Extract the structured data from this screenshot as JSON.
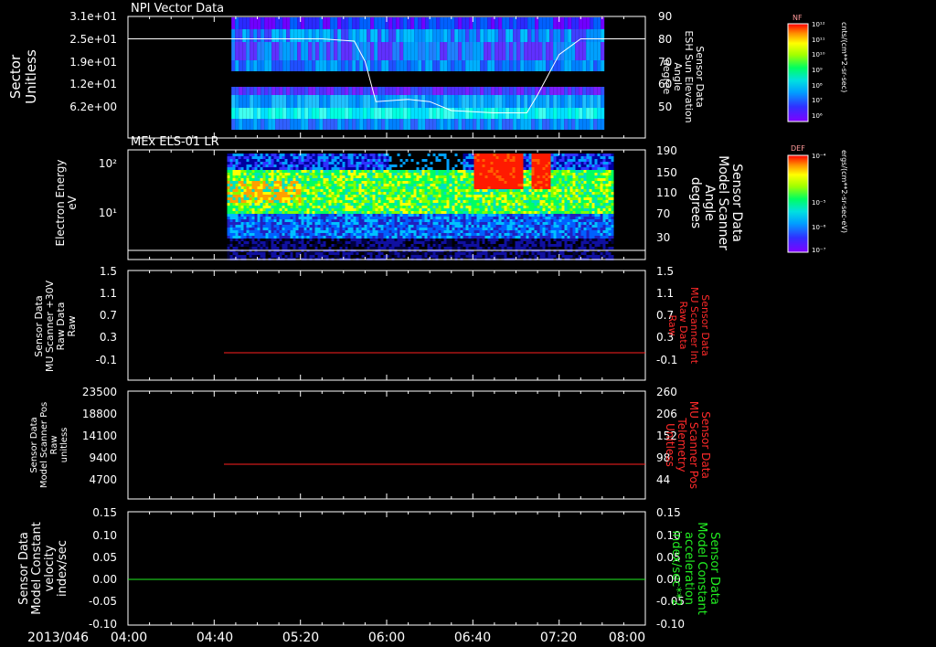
{
  "date_label": "2013/046",
  "time_ticks": [
    "04:00",
    "04:40",
    "05:20",
    "06:00",
    "06:40",
    "07:20",
    "08:00"
  ],
  "colors": {
    "background": "#000000",
    "axes": "#ffffff",
    "red_trace": "#ff2020",
    "green_trace": "#22ee22",
    "right_label_red": "#ff2a2a",
    "right_label_green": "#22ee22"
  },
  "panels": [
    {
      "title": "NPI Vector Data",
      "left_label": [
        "Sector",
        "Unitless"
      ],
      "left_ticks": [
        "3.1e+01",
        "2.5e+01",
        "1.9e+01",
        "1.2e+01",
        "6.2e+00"
      ],
      "right_label": [
        "Sensor Data",
        "ESH Sun Elevation",
        "Angle",
        "degree"
      ],
      "right_ticks": [
        "90",
        "80",
        "70",
        "60",
        "50"
      ],
      "colorbar": {
        "name": "NF",
        "units": "cnts/(cm**2-sr-sec)",
        "ticks": [
          "10¹²",
          "10¹¹",
          "10¹⁰",
          "10⁹",
          "10⁸",
          "10⁷",
          "10⁶"
        ]
      }
    },
    {
      "title": "MEx ELS-01 LR",
      "left_label": [
        "Electron Energy",
        "eV"
      ],
      "left_ticks": [
        "10²",
        "10¹"
      ],
      "right_label": [
        "Sensor Data",
        "Model Scanner",
        "Angle",
        "degrees"
      ],
      "right_ticks": [
        "190",
        "150",
        "110",
        "70",
        "30"
      ],
      "colorbar": {
        "name": "DEF",
        "units": "ergs/(cm**2-sr-sec-eV)",
        "ticks": [
          "10⁻⁴",
          "10⁻⁵",
          "10⁻⁶",
          "10⁻⁷"
        ]
      }
    },
    {
      "title": "",
      "left_label": [
        "Sensor Data",
        "MU Scanner +30V",
        "Raw Data",
        "Raw"
      ],
      "left_ticks": [
        "1.5",
        "1.1",
        "0.7",
        "0.3",
        "-0.1"
      ],
      "right_label": [
        "Sensor Data",
        "MU Scanner Int",
        "Raw Data",
        "Raw"
      ],
      "right_ticks": [
        "1.5",
        "1.1",
        "0.7",
        "0.3",
        "-0.1"
      ]
    },
    {
      "title": "",
      "left_label": [
        "Sensor Data",
        "Model Scanner Pos",
        "Raw",
        "unitless"
      ],
      "left_ticks": [
        "23500",
        "18800",
        "14100",
        "9400",
        "4700"
      ],
      "right_label": [
        "Sensor Data",
        "MU Scanner Pos",
        "Telemetry",
        "Unitless"
      ],
      "right_ticks": [
        "260",
        "206",
        "152",
        "98",
        "44"
      ]
    },
    {
      "title": "",
      "left_label": [
        "Sensor Data",
        "Model Constant",
        "velocity",
        "index/sec"
      ],
      "left_ticks": [
        "0.15",
        "0.10",
        "0.05",
        "0.00",
        "-0.05",
        "-0.10"
      ],
      "right_label": [
        "Sensor Data",
        "Model Constant",
        "acceleration",
        "index/sec**2"
      ],
      "right_ticks": [
        "0.15",
        "0.10",
        "0.05",
        "0.00",
        "-0.05",
        "-0.10"
      ]
    }
  ],
  "chart_data": [
    {
      "type": "heatmap",
      "title": "NPI Vector Data",
      "ylabel": "Sector Unitless",
      "x_range": [
        "04:00",
        "08:00"
      ],
      "data_start": "04:48",
      "data_end": "07:40",
      "overlay_line": {
        "name": "ESH Sun Elevation Angle",
        "x": [
          "04:00",
          "05:30",
          "05:45",
          "05:50",
          "05:55",
          "06:10",
          "06:20",
          "06:30",
          "06:50",
          "07:05",
          "07:10",
          "07:20",
          "07:30",
          "08:00"
        ],
        "y": [
          80,
          80,
          79,
          70,
          52,
          53,
          52,
          48,
          47,
          47,
          55,
          73,
          80,
          80
        ]
      }
    },
    {
      "type": "heatmap",
      "title": "MEx ELS-01 LR",
      "ylabel": "Electron Energy eV",
      "x_range": [
        "04:00",
        "08:00"
      ],
      "data_start": "04:46",
      "data_end": "07:45",
      "overlay_line": {
        "name": "Model Scanner Angle",
        "x": [
          "04:00",
          "08:00"
        ],
        "y": [
          10,
          10
        ]
      }
    },
    {
      "type": "line",
      "name": "MU Scanner +30V",
      "x": [
        "04:43",
        "08:00"
      ],
      "y": [
        0.0,
        0.0
      ],
      "ylim": [
        -0.3,
        1.5
      ]
    },
    {
      "type": "line",
      "name": "Model Scanner Pos",
      "x": [
        "04:43",
        "08:00"
      ],
      "y": [
        7350,
        7350
      ],
      "ylim": [
        0,
        23500
      ]
    },
    {
      "type": "line",
      "name": "Model Constant velocity",
      "x": [
        "04:00",
        "08:00"
      ],
      "y": [
        0.0,
        0.0
      ],
      "ylim": [
        -0.1,
        0.15
      ]
    }
  ]
}
